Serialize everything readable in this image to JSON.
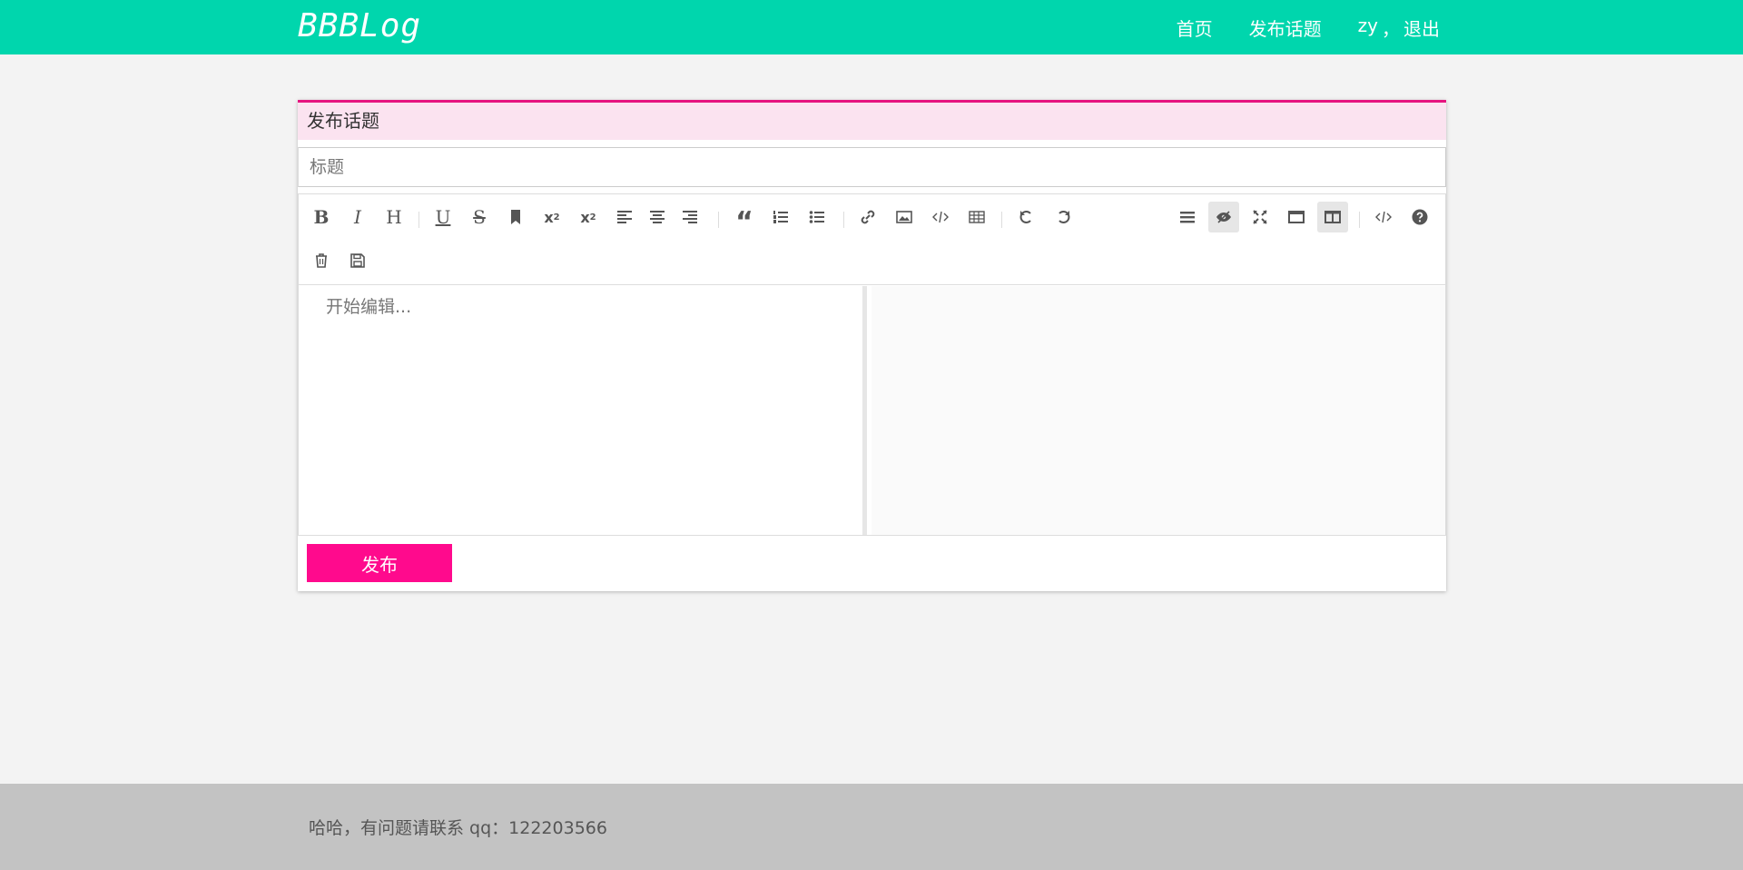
{
  "navbar": {
    "logo": "BBBLog",
    "links": [
      {
        "label": "首页"
      },
      {
        "label": "发布话题"
      }
    ],
    "user_name": "zy",
    "user_sep": "，",
    "logout": "退出",
    "bg_color": "#00d6ad"
  },
  "panel": {
    "heading": "发布话题",
    "title_placeholder": "标题",
    "editor_placeholder": "开始编辑...",
    "publish_label": "发布",
    "accent_color": "#ff0a8d"
  },
  "toolbar": {
    "row1_left": [
      "bold-icon",
      "italic-icon",
      "heading-icon",
      "underline-icon",
      "strikethrough-icon",
      "bookmark-icon",
      "superscript-icon",
      "subscript-icon",
      "align-left-icon",
      "align-center-icon",
      "align-right-icon",
      "quote-icon",
      "ordered-list-icon",
      "unordered-list-icon",
      "link-icon",
      "image-icon",
      "code-icon",
      "table-icon",
      "undo-icon",
      "redo-icon"
    ],
    "row1_right": [
      "navigation-icon",
      "preview-toggle-icon",
      "fullscreen-icon",
      "fullscreen-window-icon",
      "split-view-icon",
      "html-code-icon",
      "help-icon"
    ],
    "row2": [
      "trash-icon",
      "save-icon"
    ]
  },
  "footer": {
    "text": "哈哈，有问题请联系 qq：122203566"
  }
}
